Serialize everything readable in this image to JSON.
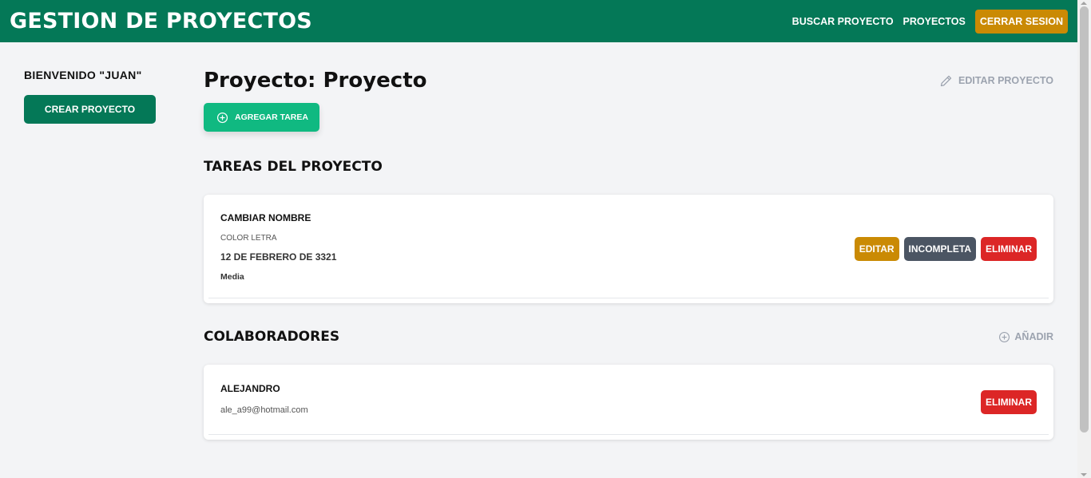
{
  "header": {
    "brand": "GESTION DE PROYECTOS",
    "nav": {
      "search": "BUSCAR PROYECTO",
      "projects": "PROYECTOS",
      "logout": "CERRAR SESION"
    }
  },
  "sidebar": {
    "welcome": "BIENVENIDO \"JUAN\"",
    "create_button": "CREAR PROYECTO"
  },
  "main": {
    "title": "Proyecto: Proyecto",
    "edit_project": "EDITAR PROYECTO",
    "add_task": "AGREGAR TAREA",
    "tasks_title": "TAREAS DEL PROYECTO",
    "tasks": [
      {
        "name": "CAMBIAR NOMBRE",
        "description": "COLOR LETRA",
        "date": "12 DE FEBRERO DE 3321",
        "priority": "Media",
        "edit": "EDITAR",
        "status": "INCOMPLETA",
        "delete": "ELIMINAR"
      }
    ],
    "collaborators_title": "COLABORADORES",
    "add_collaborator": "AÑADIR",
    "collaborators": [
      {
        "name": "ALEJANDRO",
        "email": "ale_a99@hotmail.com",
        "delete": "ELIMINAR"
      }
    ]
  },
  "colors": {
    "primary": "#047857",
    "accent": "#ca8a04",
    "success": "#10b981",
    "danger": "#dc2626",
    "neutral": "#4b5563"
  },
  "icons": {
    "edit_project": "pencil-icon",
    "add_task": "plus-circle-icon",
    "add_collaborator": "plus-circle-icon"
  }
}
